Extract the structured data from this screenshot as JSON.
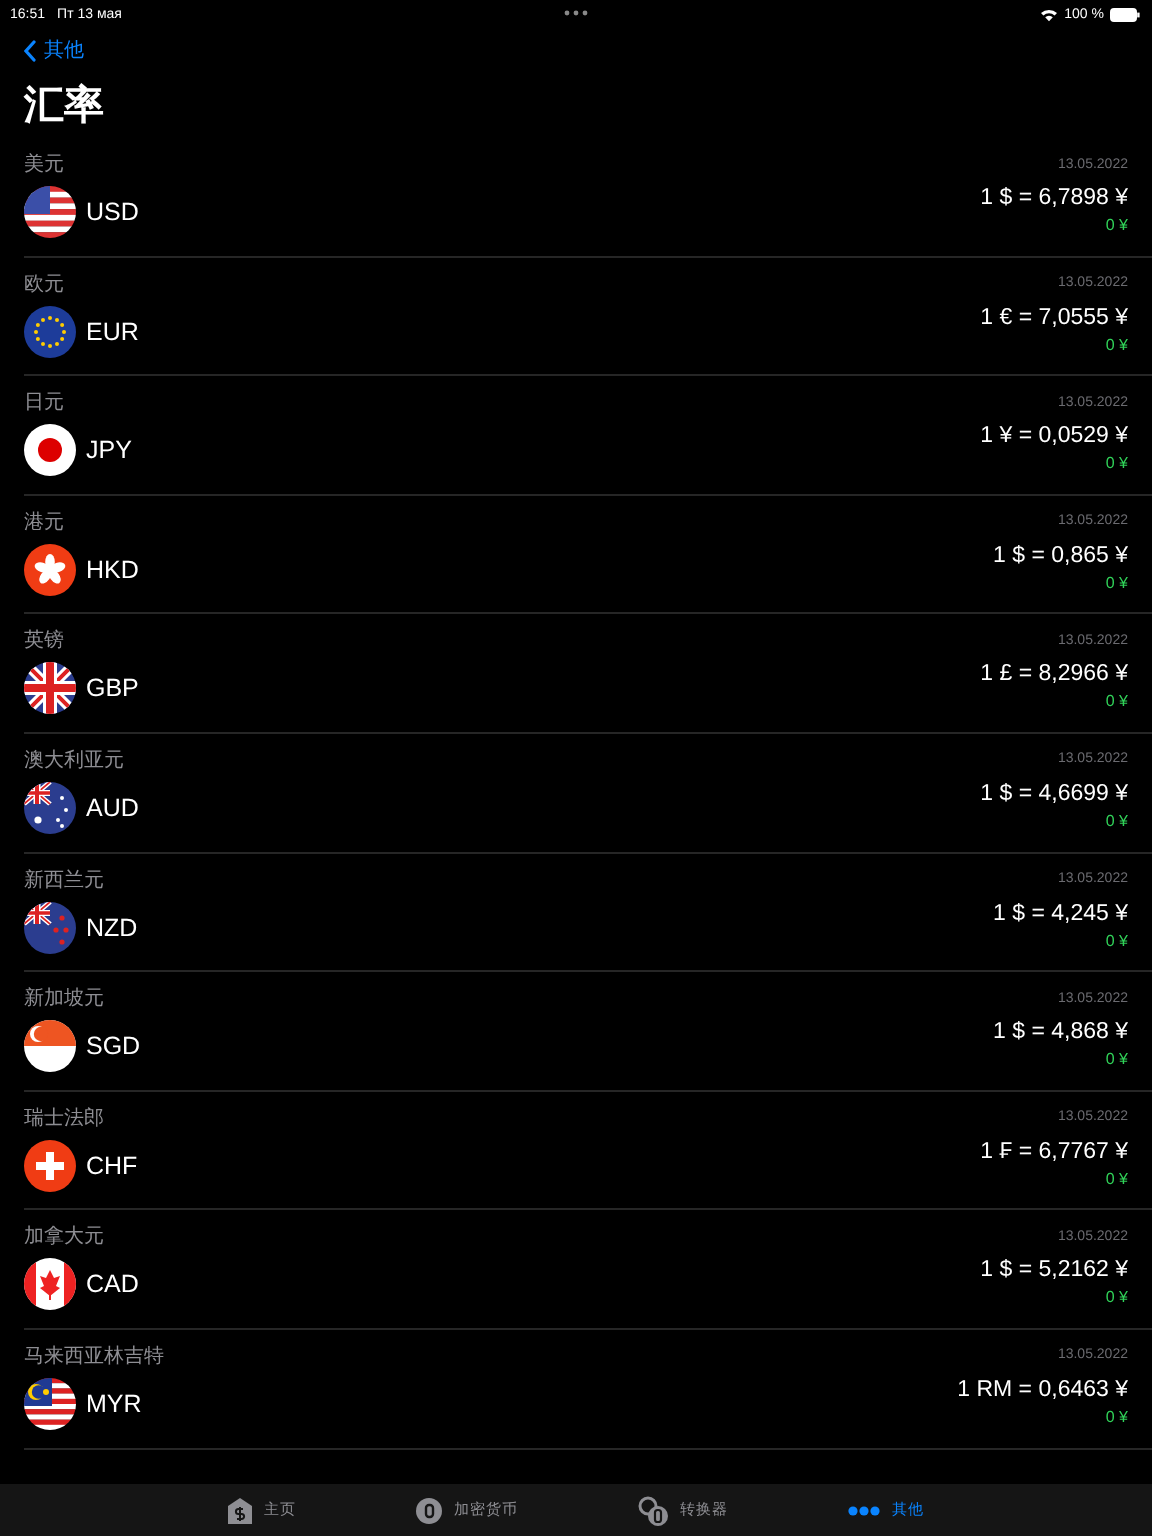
{
  "status_bar": {
    "time": "16:51",
    "date": "Пт 13 мая",
    "battery": "100 %"
  },
  "nav": {
    "back": "其他",
    "title": "汇率"
  },
  "rates": [
    {
      "name": "美元",
      "code": "USD",
      "kind": "us",
      "date": "13.05.2022",
      "rate": "1 $ = 6,7898 ¥",
      "change": "0 ¥"
    },
    {
      "name": "欧元",
      "code": "EUR",
      "kind": "eu",
      "date": "13.05.2022",
      "rate": "1 € = 7,0555 ¥",
      "change": "0 ¥"
    },
    {
      "name": "日元",
      "code": "JPY",
      "kind": "jp",
      "date": "13.05.2022",
      "rate": "1 ¥ = 0,0529 ¥",
      "change": "0 ¥"
    },
    {
      "name": "港元",
      "code": "HKD",
      "kind": "hk",
      "date": "13.05.2022",
      "rate": "1 $ = 0,865 ¥",
      "change": "0 ¥"
    },
    {
      "name": "英镑",
      "code": "GBP",
      "kind": "gb",
      "date": "13.05.2022",
      "rate": "1 £ = 8,2966 ¥",
      "change": "0 ¥"
    },
    {
      "name": "澳大利亚元",
      "code": "AUD",
      "kind": "au",
      "date": "13.05.2022",
      "rate": "1 $ = 4,6699 ¥",
      "change": "0 ¥"
    },
    {
      "name": "新西兰元",
      "code": "NZD",
      "kind": "nz",
      "date": "13.05.2022",
      "rate": "1 $ = 4,245 ¥",
      "change": "0 ¥"
    },
    {
      "name": "新加坡元",
      "code": "SGD",
      "kind": "sg",
      "date": "13.05.2022",
      "rate": "1 $ = 4,868 ¥",
      "change": "0 ¥"
    },
    {
      "name": "瑞士法郎",
      "code": "CHF",
      "kind": "ch",
      "date": "13.05.2022",
      "rate": "1 ₣ = 6,7767 ¥",
      "change": "0 ¥"
    },
    {
      "name": "加拿大元",
      "code": "CAD",
      "kind": "ca",
      "date": "13.05.2022",
      "rate": "1 $ = 5,2162 ¥",
      "change": "0 ¥"
    },
    {
      "name": "马来西亚林吉特",
      "code": "MYR",
      "kind": "my",
      "date": "13.05.2022",
      "rate": "1 RM = 0,6463 ¥",
      "change": "0 ¥"
    }
  ],
  "tabs": [
    {
      "label": "主页",
      "kind": "home",
      "selected": false
    },
    {
      "label": "加密货币",
      "kind": "coin",
      "selected": false
    },
    {
      "label": "转换器",
      "kind": "exchange",
      "selected": false
    },
    {
      "label": "其他",
      "kind": "more",
      "selected": true
    }
  ]
}
